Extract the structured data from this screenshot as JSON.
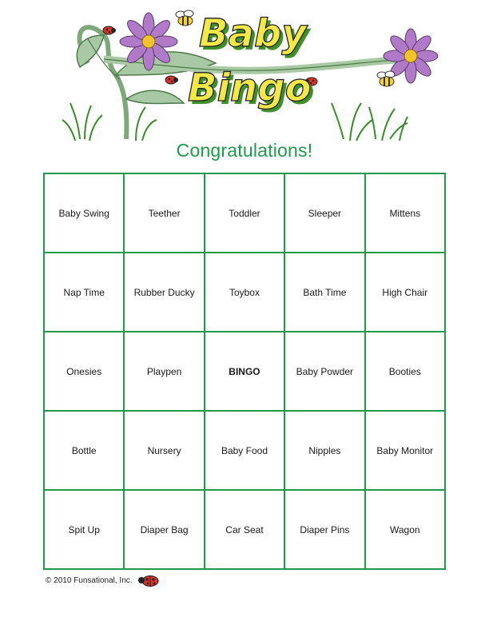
{
  "header": {
    "title_line1": "Baby",
    "title_line2": "Bingo",
    "subtitle": "Congratulations!"
  },
  "board": {
    "rows": [
      [
        "Baby Swing",
        "Teether",
        "Toddler",
        "Sleeper",
        "Mittens"
      ],
      [
        "Nap Time",
        "Rubber Ducky",
        "Toybox",
        "Bath Time",
        "High Chair"
      ],
      [
        "Onesies",
        "Playpen",
        "BINGO",
        "Baby Powder",
        "Booties"
      ],
      [
        "Bottle",
        "Nursery",
        "Baby Food",
        "Nipples",
        "Baby Monitor"
      ],
      [
        "Spit Up",
        "Diaper Bag",
        "Car Seat",
        "Diaper Pins",
        "Wagon"
      ]
    ]
  },
  "footer": {
    "copyright": "© 2010 Funsational, Inc."
  },
  "colors": {
    "accent": "#1f9a4a",
    "title_fill": "#f3e84a",
    "title_shadow": "#3f8f2a",
    "flower": "#b07ac8",
    "leaf": "#a9c9a4"
  },
  "icons": [
    "flower-icon",
    "bee-icon",
    "ladybug-icon",
    "grass-icon",
    "vine-icon"
  ]
}
